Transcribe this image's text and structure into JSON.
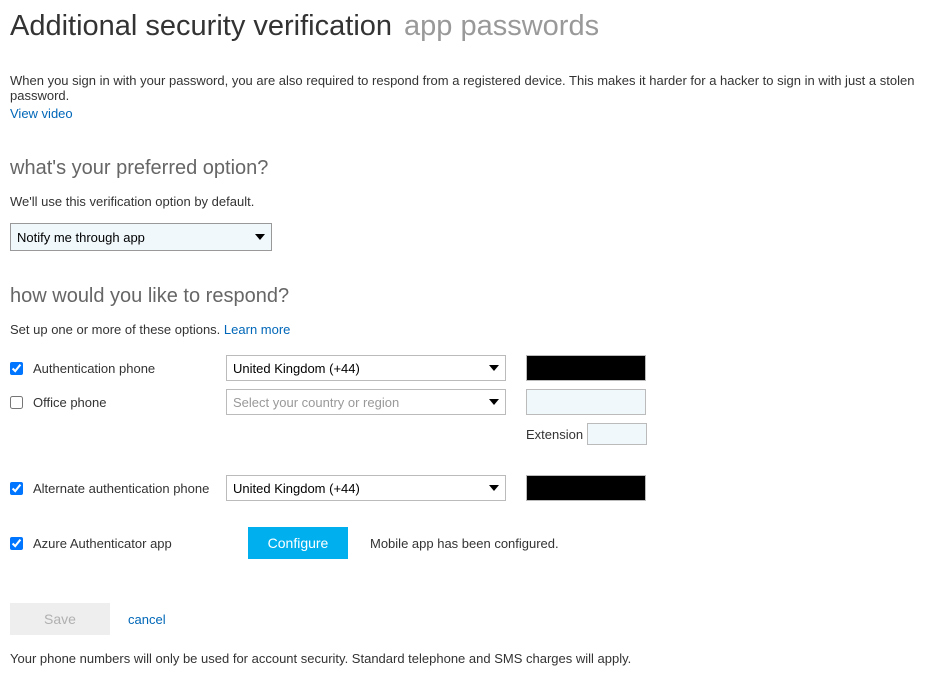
{
  "header": {
    "title": "Additional security verification",
    "subtitle": "app passwords"
  },
  "intro": {
    "text": "When you sign in with your password, you are also required to respond from a registered device. This makes it harder for a hacker to sign in with just a stolen password.",
    "link": "View video"
  },
  "preferred": {
    "title": "what's your preferred option?",
    "desc": "We'll use this verification option by default.",
    "selected": "Notify me through app"
  },
  "respond": {
    "title": "how would you like to respond?",
    "desc": "Set up one or more of these options. ",
    "learn_more": "Learn more"
  },
  "options": {
    "auth_phone": {
      "label": "Authentication phone",
      "country": "United Kingdom (+44)"
    },
    "office_phone": {
      "label": "Office phone",
      "placeholder": "Select your country or region",
      "ext_label": "Extension"
    },
    "alt_phone": {
      "label": "Alternate authentication phone",
      "country": "United Kingdom (+44)"
    },
    "app": {
      "label": "Azure Authenticator app",
      "configure": "Configure",
      "status": "Mobile app has been configured."
    }
  },
  "footer": {
    "save": "Save",
    "cancel": "cancel",
    "note": "Your phone numbers will only be used for account security. Standard telephone and SMS charges will apply."
  }
}
